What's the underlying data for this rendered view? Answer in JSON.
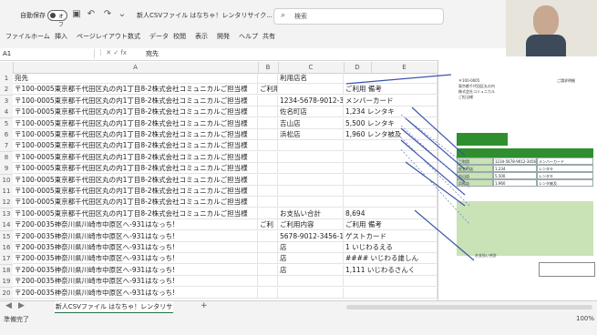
{
  "titlebar": {
    "autosave_label": "自動保存",
    "toggle_text": "オフ",
    "doc_title": "新人CSVファイル はなちゃ！レンタリサイク...",
    "search_placeholder": "検索"
  },
  "menu": [
    "ファイル",
    "ホーム",
    "挿入",
    "ページレイアウト",
    "数式",
    "データ",
    "校閲",
    "表示",
    "開発",
    "ヘルプ",
    "共有"
  ],
  "formula": {
    "namebox": "A1",
    "fx": "fx",
    "value": "宛先"
  },
  "columns": [
    "A",
    "B",
    "C",
    "D",
    "E"
  ],
  "rows": [
    {
      "n": "1",
      "a": "宛先",
      "b": "",
      "c": "利用店名",
      "d": "",
      "e": ""
    },
    {
      "n": "2",
      "a": "〒100-0005東京都千代田区丸の内1丁目8-2株式会社コミュニカルご担当様",
      "b": "ご利用店舗",
      "c": "",
      "d": "ご利用 備考",
      "e": ""
    },
    {
      "n": "3",
      "a": "〒100-0005東京都千代田区丸の内1丁目8-2株式会社コミュニカルご担当様",
      "b": "",
      "c": "1234-5678-9012-3456",
      "d": "メンバーカード",
      "e": ""
    },
    {
      "n": "4",
      "a": "〒100-0005東京都千代田区丸の内1丁目8-2株式会社コミュニカルご担当様",
      "b": "",
      "c": "佐名町店",
      "d": "1,234 レンタキ",
      "e": ""
    },
    {
      "n": "5",
      "a": "〒100-0005東京都千代田区丸の内1丁目8-2株式会社コミュニカルご担当様",
      "b": "",
      "c": "吉山店",
      "d": "5,500 レンタキ",
      "e": ""
    },
    {
      "n": "6",
      "a": "〒100-0005東京都千代田区丸の内1丁目8-2株式会社コミュニカルご担当様",
      "b": "",
      "c": "浜松店",
      "d": "1,960 レンタ被及",
      "e": ""
    },
    {
      "n": "7",
      "a": "〒100-0005東京都千代田区丸の内1丁目8-2株式会社コミュニカルご担当様",
      "b": "",
      "c": "",
      "d": "",
      "e": ""
    },
    {
      "n": "8",
      "a": "〒100-0005東京都千代田区丸の内1丁目8-2株式会社コミュニカルご担当様",
      "b": "",
      "c": "",
      "d": "",
      "e": ""
    },
    {
      "n": "9",
      "a": "〒100-0005東京都千代田区丸の内1丁目8-2株式会社コミュニカルご担当様",
      "b": "",
      "c": "",
      "d": "",
      "e": ""
    },
    {
      "n": "10",
      "a": "〒100-0005東京都千代田区丸の内1丁目8-2株式会社コミュニカルご担当様",
      "b": "",
      "c": "",
      "d": "",
      "e": ""
    },
    {
      "n": "11",
      "a": "〒100-0005東京都千代田区丸の内1丁目8-2株式会社コミュニカルご担当様",
      "b": "",
      "c": "",
      "d": "",
      "e": ""
    },
    {
      "n": "12",
      "a": "〒100-0005東京都千代田区丸の内1丁目8-2株式会社コミュニカルご担当様",
      "b": "",
      "c": "",
      "d": "",
      "e": ""
    },
    {
      "n": "13",
      "a": "〒100-0005東京都千代田区丸の内1丁目8-2株式会社コミュニカルご担当様",
      "b": "",
      "c": "お支払い合計",
      "d": "8,694",
      "e": ""
    },
    {
      "n": "14",
      "a": "〒200-0035神奈川県川崎市中原区へ-931はなっち!",
      "b": "ご利",
      "c": "ご利用内容",
      "d": "ご利用 備考",
      "e": ""
    },
    {
      "n": "15",
      "a": "〒200-0035神奈川県川崎市中原区へ-931はなっち!",
      "b": "",
      "c": "5678-9012-3456-1234",
      "d": "ゲストカード",
      "e": ""
    },
    {
      "n": "16",
      "a": "〒200-0035神奈川県川崎市中原区へ-931はなっち!",
      "b": "",
      "c": "店",
      "d": "1 いじわるえる",
      "e": ""
    },
    {
      "n": "17",
      "a": "〒200-0035神奈川県川崎市中原区へ-931はなっち!",
      "b": "",
      "c": "店",
      "d": "#### いじわる誰しん",
      "e": ""
    },
    {
      "n": "18",
      "a": "〒200-0035神奈川県川崎市中原区へ-931はなっち!",
      "b": "",
      "c": "店",
      "d": "1,111 いじわるさんく",
      "e": ""
    },
    {
      "n": "19",
      "a": "〒200-0035神奈川県川崎市中原区へ-931はなっち!",
      "b": "",
      "c": "",
      "d": "",
      "e": ""
    },
    {
      "n": "20",
      "a": "〒200-0035神奈川県川崎市中原区へ-931はなっち!",
      "b": "",
      "c": "",
      "d": "",
      "e": ""
    }
  ],
  "preview": {
    "header_lines": [
      "〒100-0005",
      "東京都千代田区丸の内",
      "株式会社コミュニカル",
      "ご担当様"
    ],
    "right_title": "ご請求明細",
    "table_rows": [
      [
        "ご利用",
        "1234-5678-9012-3456",
        "メンバーカード"
      ],
      [
        "佐名町店",
        "1,234",
        "レンタキ"
      ],
      [
        "吉山店",
        "5,500",
        "レンタキ"
      ],
      [
        "浜松店",
        "1,960",
        "レンタ被及"
      ]
    ],
    "total_label": "お支払い合計"
  },
  "sheet_tab": "新人CSVファイル はなちゃ！レンタリサイクル",
  "status": {
    "left": "準備完了",
    "zoom": "100%"
  },
  "colors": {
    "excel_green": "#217346",
    "table_green": "#c9e2b6"
  }
}
